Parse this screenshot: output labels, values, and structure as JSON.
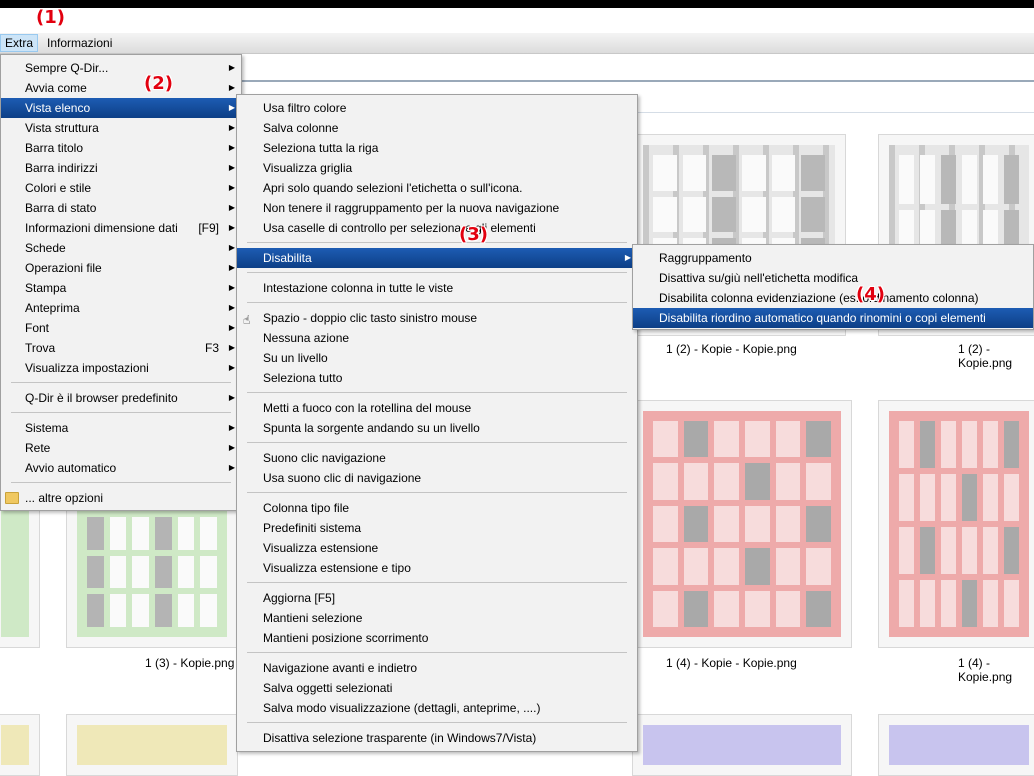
{
  "menubar": {
    "items": [
      {
        "label": "Extra",
        "active": true
      },
      {
        "label": "Informazioni",
        "active": false
      }
    ]
  },
  "annotations": [
    "(1)",
    "(2)",
    "(3)",
    "(4)"
  ],
  "extra_menu": {
    "items": [
      {
        "label": "Sempre Q-Dir...",
        "submenu": true
      },
      {
        "label": "Avvia come",
        "submenu": true
      },
      {
        "label": "Vista elenco",
        "submenu": true,
        "highlighted": true
      },
      {
        "label": "Vista struttura",
        "submenu": true
      },
      {
        "label": "Barra titolo",
        "submenu": true
      },
      {
        "label": "Barra indirizzi",
        "submenu": true
      },
      {
        "label": "Colori e stile",
        "submenu": true
      },
      {
        "label": "Barra di stato",
        "submenu": true
      },
      {
        "label": "Informazioni dimensione dati",
        "shortcut": "[F9]",
        "submenu": true
      },
      {
        "label": "Schede",
        "submenu": true
      },
      {
        "label": "Operazioni file",
        "submenu": true
      },
      {
        "label": "Stampa",
        "submenu": true
      },
      {
        "label": "Anteprima",
        "submenu": true
      },
      {
        "label": "Font",
        "submenu": true
      },
      {
        "label": "Trova",
        "shortcut": "F3",
        "submenu": true
      },
      {
        "label": "Visualizza impostazioni",
        "submenu": true
      },
      {
        "label": "Q-Dir è il browser predefinito",
        "submenu": true
      },
      {
        "label": "Sistema",
        "submenu": true
      },
      {
        "label": "Rete",
        "submenu": true
      },
      {
        "label": "Avvio automatico",
        "submenu": true
      },
      {
        "label": "... altre opzioni",
        "icon": "folder-icon"
      }
    ]
  },
  "vista_elenco_menu": {
    "items": [
      {
        "label": "Usa filtro colore"
      },
      {
        "label": "Salva colonne"
      },
      {
        "label": "Seleziona tutta la riga"
      },
      {
        "label": "Visualizza griglia"
      },
      {
        "label": "Apri solo quando selezioni l'etichetta o sull'icona."
      },
      {
        "label": "Non tenere il raggruppamento per la nuova navigazione"
      },
      {
        "label": "Usa caselle di controllo per selezionare gli elementi"
      },
      {
        "label": "Disabilita",
        "submenu": true,
        "highlighted": true
      },
      {
        "label": "Intestazione colonna in tutte le viste"
      },
      {
        "label": "Spazio - doppio clic tasto sinistro mouse",
        "icon": "mouse-icon"
      },
      {
        "label": "Nessuna azione"
      },
      {
        "label": "Su un livello"
      },
      {
        "label": "Seleziona tutto"
      },
      {
        "label": "Metti a fuoco con la rotellina del mouse"
      },
      {
        "label": "Spunta la sorgente andando su un livello"
      },
      {
        "label": "Suono clic navigazione"
      },
      {
        "label": "Usa suono clic di navigazione"
      },
      {
        "label": "Colonna tipo file"
      },
      {
        "label": "Predefiniti sistema"
      },
      {
        "label": "Visualizza estensione"
      },
      {
        "label": "Visualizza estensione e tipo"
      },
      {
        "label": "Aggiorna [F5]"
      },
      {
        "label": "Mantieni selezione"
      },
      {
        "label": "Mantieni posizione scorrimento"
      },
      {
        "label": "Navigazione avanti e indietro"
      },
      {
        "label": "Salva oggetti selezionati"
      },
      {
        "label": "Salva modo visualizzazione (dettagli, anteprime, ....)"
      },
      {
        "label": "Disattiva selezione trasparente (in Windows7/Vista)"
      }
    ]
  },
  "disabilita_menu": {
    "items": [
      {
        "label": "Raggruppamento"
      },
      {
        "label": "Disattiva su/giù nell'etichetta modifica"
      },
      {
        "label": "Disabilita colonna evidenziazione (es. ordinamento colonna)"
      },
      {
        "label": "Disabilita riordino automatico quando rinomini o copi elementi",
        "highlighted": true
      }
    ]
  },
  "thumbnails": {
    "captions": [
      "1 (2) - Kopie - Kopie.png",
      "1 (2) - Kopie.png",
      "1 (3) - Kopie.png",
      "1 (4) - Kopie - Kopie.png",
      "1 (4) - Kopie.png"
    ]
  },
  "colors": {
    "highlight": "#0d3f86",
    "annotation": "#e2000f",
    "menu_bg": "#f2f2f2"
  }
}
